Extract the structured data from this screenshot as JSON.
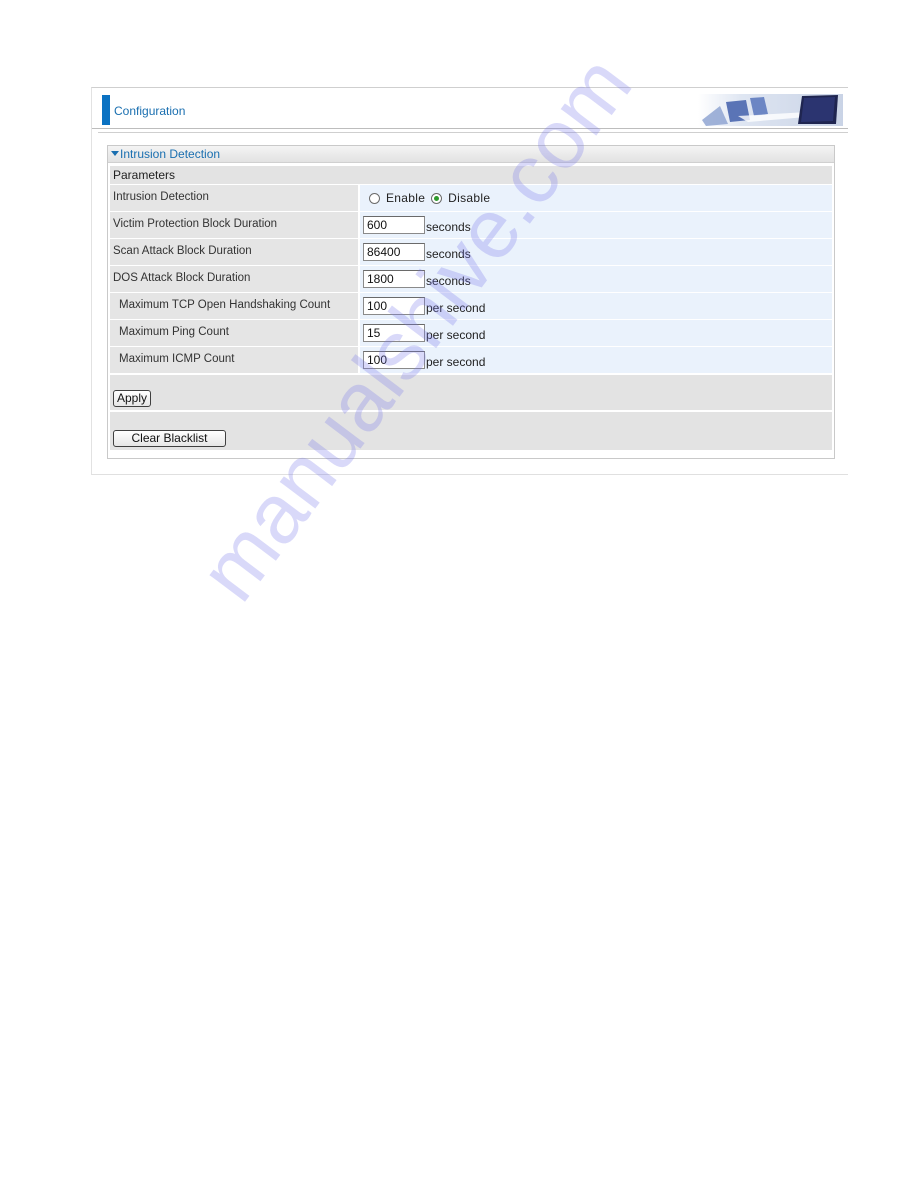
{
  "header": {
    "title": "Configuration",
    "banner_icon": "office-banner-image"
  },
  "panel": {
    "title": "Intrusion Detection",
    "section_label": "Parameters",
    "rows": [
      {
        "label": "Intrusion Detection",
        "type": "radio",
        "options": [
          {
            "label": "Enable",
            "checked": false
          },
          {
            "label": "Disable",
            "checked": true
          }
        ]
      },
      {
        "label": "Victim Protection Block Duration",
        "type": "text",
        "value": "600",
        "unit": "seconds"
      },
      {
        "label": "Scan Attack Block Duration",
        "type": "text",
        "value": "86400",
        "unit": "seconds"
      },
      {
        "label": "DOS Attack Block Duration",
        "type": "text",
        "value": "1800",
        "unit": "seconds"
      },
      {
        "label": "Maximum TCP Open Handshaking Count",
        "type": "text",
        "value": "100",
        "unit": "per second"
      },
      {
        "label": "Maximum Ping Count",
        "type": "text",
        "value": "15",
        "unit": "per second"
      },
      {
        "label": "Maximum ICMP Count",
        "type": "text",
        "value": "100",
        "unit": "per second"
      }
    ],
    "apply_label": "Apply",
    "clear_blacklist_label": "Clear Blacklist"
  },
  "colors": {
    "accent": "#0b72c2",
    "link_text": "#1a6fb0",
    "label_bg": "#e5e5e5",
    "value_bg": "#eaf2fc",
    "radio_checked": "#2e9a2e"
  },
  "watermark": "manualshive.com"
}
